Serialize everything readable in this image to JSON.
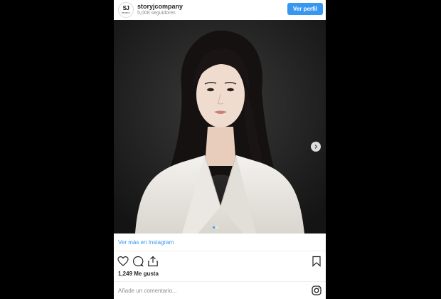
{
  "header": {
    "avatar_mark": "SJ",
    "avatar_sub": "STORY J",
    "username": "storyjcompany",
    "followers": "5,008 seguidores",
    "profile_button": "Ver perfil"
  },
  "post": {
    "view_more_link": "Ver más en Instagram",
    "likes": "1,249 Me gusta",
    "comment_placeholder": "Añade un comentario...",
    "carousel_count": 2,
    "carousel_active": 1
  },
  "colors": {
    "accent": "#3897f0",
    "background": "#000000",
    "card": "#ffffff"
  },
  "icons": [
    "heart-icon",
    "comment-icon",
    "share-icon",
    "bookmark-icon",
    "instagram-icon",
    "chevron-right-icon"
  ]
}
